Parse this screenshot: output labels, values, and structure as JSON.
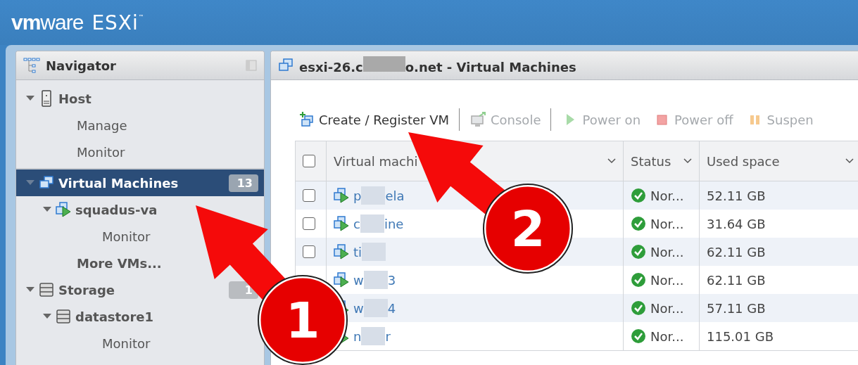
{
  "brand": {
    "logo": "**vm**ware",
    "product": "ESXi",
    "trademark": "™"
  },
  "navigator": {
    "title": "Navigator",
    "items": [
      {
        "label": "Host",
        "kind": "host",
        "selected": false,
        "children": [
          {
            "label": "Manage",
            "kind": "page",
            "selected": false
          },
          {
            "label": "Monitor",
            "kind": "page",
            "selected": false
          }
        ]
      },
      {
        "label": "Virtual Machines",
        "kind": "vms",
        "selected": true,
        "count": "13",
        "children": [
          {
            "label": "squadus-va",
            "kind": "vm",
            "selected": false,
            "children": [
              {
                "label": "Monitor",
                "kind": "page",
                "selected": false
              }
            ]
          },
          {
            "label": "More VMs...",
            "kind": "more",
            "selected": false
          }
        ]
      },
      {
        "label": "Storage",
        "kind": "storage",
        "selected": false,
        "count": "1",
        "children": [
          {
            "label": "datastore1",
            "kind": "datastore",
            "selected": false,
            "children": [
              {
                "label": "Monitor",
                "kind": "page",
                "selected": false
              }
            ]
          }
        ]
      }
    ]
  },
  "content": {
    "title_start": "esxi-26.c",
    "title_end": "o.net - Virtual Machines",
    "toolbar": [
      {
        "label": "Create / Register VM",
        "disabled": false
      },
      {
        "label": "Console",
        "disabled": true
      },
      {
        "label": "Power on",
        "disabled": true
      },
      {
        "label": "Power off",
        "disabled": true
      },
      {
        "label": "Suspen",
        "disabled": true
      }
    ],
    "table": {
      "all_checked": false,
      "columns": [
        "Virtual machi",
        "Status",
        "Used space"
      ],
      "rows": [
        {
          "checked": false,
          "name_start": "p",
          "name_end": "ela",
          "status": "Nor...",
          "used": "52.11 GB"
        },
        {
          "checked": false,
          "name_start": "c",
          "name_end": "ine",
          "status": "Nor...",
          "used": "31.64 GB"
        },
        {
          "checked": false,
          "name_start": "ti",
          "name_end": "",
          "status": "Nor...",
          "used": "62.11 GB"
        },
        {
          "name_start": "w",
          "name_end": "3",
          "status": "Nor...",
          "used": "62.11 GB"
        },
        {
          "name_start": "w",
          "name_end": "4",
          "status": "Nor...",
          "used": "57.11 GB"
        },
        {
          "name_start": "n",
          "name_end": "r",
          "status": "Nor...",
          "used": "115.01 GB"
        }
      ]
    }
  },
  "annotations": [
    {
      "number": "1"
    },
    {
      "number": "2"
    }
  ]
}
